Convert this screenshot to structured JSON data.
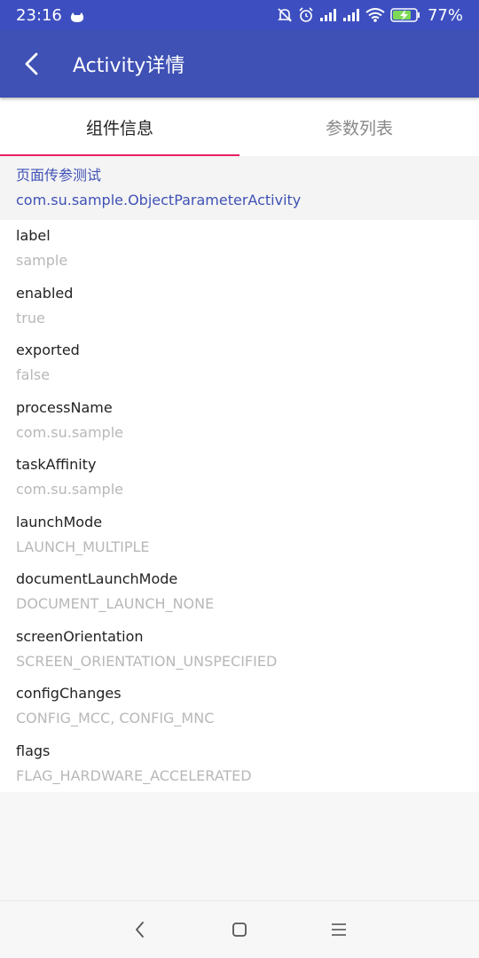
{
  "status": {
    "time": "23:16",
    "battery": "77%"
  },
  "appbar": {
    "title": "Activity详情"
  },
  "tabs": [
    {
      "label": "组件信息",
      "active": true
    },
    {
      "label": "参数列表",
      "active": false
    }
  ],
  "header": {
    "title": "页面传参测试",
    "subtitle": "com.su.sample.ObjectParameterActivity"
  },
  "properties": [
    {
      "key": "label",
      "value": "sample"
    },
    {
      "key": "enabled",
      "value": "true"
    },
    {
      "key": "exported",
      "value": "false"
    },
    {
      "key": "processName",
      "value": "com.su.sample"
    },
    {
      "key": "taskAffinity",
      "value": "com.su.sample"
    },
    {
      "key": "launchMode",
      "value": "LAUNCH_MULTIPLE"
    },
    {
      "key": "documentLaunchMode",
      "value": "DOCUMENT_LAUNCH_NONE"
    },
    {
      "key": "screenOrientation",
      "value": "SCREEN_ORIENTATION_UNSPECIFIED"
    },
    {
      "key": "configChanges",
      "value": "CONFIG_MCC, CONFIG_MNC"
    },
    {
      "key": "flags",
      "value": "FLAG_HARDWARE_ACCELERATED"
    }
  ],
  "colors": {
    "primary": "#3f51b5",
    "status_bar": "#3d4fc0",
    "accent": "#e91e63"
  },
  "icons": {
    "back": "arrow-back-icon",
    "nav_back": "nav-back-icon",
    "nav_home": "nav-home-icon",
    "nav_menu": "nav-menu-icon"
  }
}
